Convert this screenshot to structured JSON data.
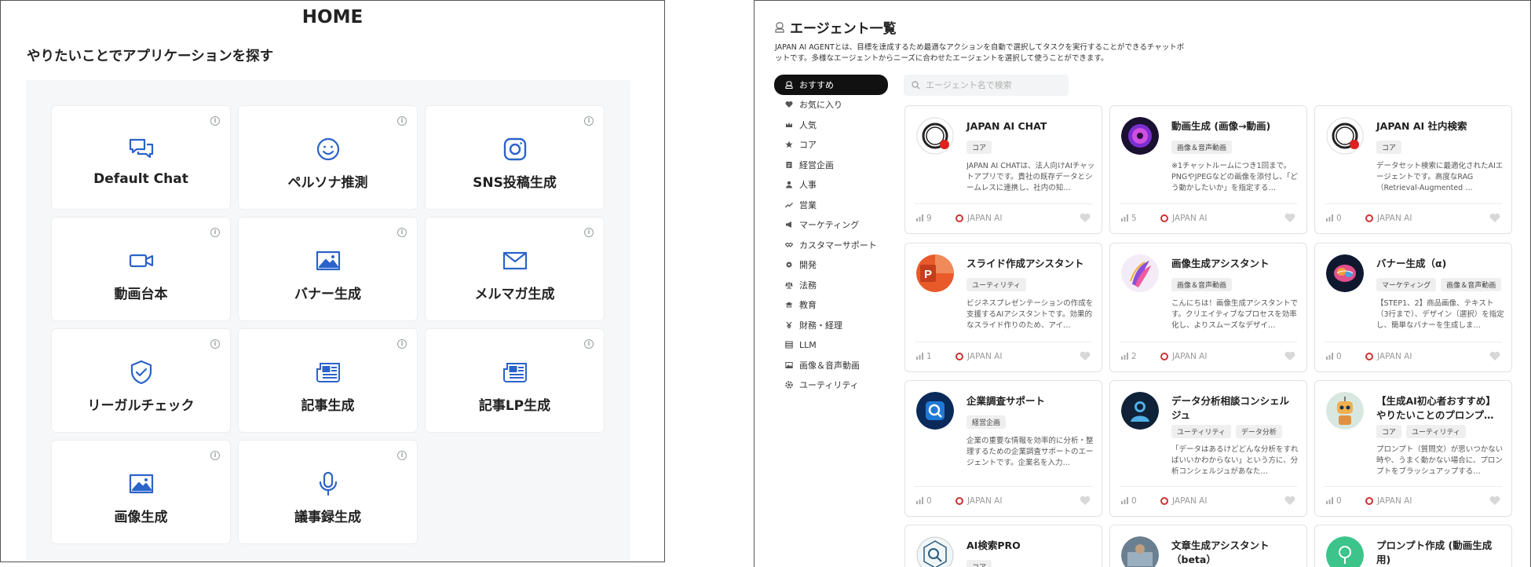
{
  "home": {
    "title": "HOME",
    "section_title": "やりたいことでアプリケーションを探す",
    "info_glyph": "i",
    "apps": [
      {
        "label": "Default Chat",
        "icon": "chat-bubbles-icon"
      },
      {
        "label": "ペルソナ推測",
        "icon": "smiley-icon"
      },
      {
        "label": "SNS投稿生成",
        "icon": "instagram-icon"
      },
      {
        "label": "動画台本",
        "icon": "video-camera-icon"
      },
      {
        "label": "バナー生成",
        "icon": "image-icon"
      },
      {
        "label": "メルマガ生成",
        "icon": "mail-icon"
      },
      {
        "label": "リーガルチェック",
        "icon": "shield-check-icon"
      },
      {
        "label": "記事生成",
        "icon": "newspaper-icon"
      },
      {
        "label": "記事LP生成",
        "icon": "newspaper-icon"
      },
      {
        "label": "画像生成",
        "icon": "image-icon"
      },
      {
        "label": "議事録生成",
        "icon": "microphone-icon"
      }
    ],
    "accent_color": "#2b63c9"
  },
  "agents": {
    "title": "エージェント一覧",
    "description": "JAPAN AI AGENTとは、目標を達成するため最適なアクションを自動で選択してタスクを実行することができるチャットボットです。多様なエージェントからニーズに合わせたエージェントを選択して使うことができます。",
    "search_placeholder": "エージェント名で検索",
    "sidebar": [
      {
        "label": "おすすめ",
        "icon": "person-icon",
        "active": true
      },
      {
        "label": "お気に入り",
        "icon": "heart-icon"
      },
      {
        "label": "人気",
        "icon": "crown-icon"
      },
      {
        "label": "コア",
        "icon": "star-icon"
      },
      {
        "label": "経営企画",
        "icon": "document-icon"
      },
      {
        "label": "人事",
        "icon": "person-icon"
      },
      {
        "label": "営業",
        "icon": "trend-icon"
      },
      {
        "label": "マーケティング",
        "icon": "megaphone-icon"
      },
      {
        "label": "カスタマーサポート",
        "icon": "handshake-icon"
      },
      {
        "label": "開発",
        "icon": "gear-icon"
      },
      {
        "label": "法務",
        "icon": "scales-icon"
      },
      {
        "label": "教育",
        "icon": "graduation-icon"
      },
      {
        "label": "財務・経理",
        "icon": "yen-icon"
      },
      {
        "label": "LLM",
        "icon": "server-icon"
      },
      {
        "label": "画像＆音声動画",
        "icon": "image-icon"
      },
      {
        "label": "ユーティリティ",
        "icon": "gear-icon"
      }
    ],
    "cards": [
      {
        "title": "JAPAN AI CHAT",
        "tags": [
          "コア"
        ],
        "desc": "JAPAN AI CHATは、法人向けAIチャットアプリです。貴社の既存データとシームレスに連携し、社内の知…",
        "count": "9",
        "brand": "JAPAN AI",
        "avatar": "ring-avatar"
      },
      {
        "title": "動画生成 (画像→動画)",
        "tags": [
          "画像＆音声動画"
        ],
        "desc": "※1チャットルームにつき1回まで。PNGやJPEGなどの画像を添付し、「どう動かしたいか」を指定する…",
        "count": "5",
        "brand": "JAPAN AI",
        "avatar": "purple-orb-avatar"
      },
      {
        "title": "JAPAN AI 社内検索",
        "tags": [
          "コア"
        ],
        "desc": "データセット検索に最適化されたAIエージェントです。高度なRAG（Retrieval-Augmented …",
        "count": "0",
        "brand": "JAPAN AI",
        "avatar": "ring-avatar"
      },
      {
        "title": "スライド作成アシスタント",
        "tags": [
          "ユーティリティ"
        ],
        "desc": "ビジネスプレゼンテーションの作成を支援するAIアシスタントです。効果的なスライド作りのため、アイ…",
        "count": "1",
        "brand": "JAPAN AI",
        "avatar": "ppt-avatar"
      },
      {
        "title": "画像生成アシスタント",
        "tags": [
          "画像＆音声動画"
        ],
        "desc": "こんにちは！画像生成アシスタントです。クリエイティブなプロセスを効率化し、よりスムーズなデザイ…",
        "count": "2",
        "brand": "JAPAN AI",
        "avatar": "paint-avatar"
      },
      {
        "title": "バナー生成（α)",
        "tags": [
          "マーケティング",
          "画像＆音声動画"
        ],
        "desc": "【STEP1、2】商品画像、テキスト（3行まで）、デザイン（選択）を指定し、簡単なバナーを生成しま…",
        "count": "0",
        "brand": "JAPAN AI",
        "avatar": "brain-avatar"
      },
      {
        "title": "企業調査サポート",
        "tags": [
          "経営企画"
        ],
        "desc": "企業の重要な情報を効率的に分析・整理するための企業調査サポートのエージェントです。企業名を入力…",
        "count": "0",
        "brand": "JAPAN AI",
        "avatar": "search-app-avatar"
      },
      {
        "title": "データ分析相談コンシェルジュ",
        "tags": [
          "ユーティリティ",
          "データ分析"
        ],
        "desc": "「データはあるけどどんな分析をすればいいかわからない」という方に、分析コンシェルジュがあなた…",
        "count": "0",
        "brand": "JAPAN AI",
        "avatar": "concierge-avatar"
      },
      {
        "title": "【生成AI初心者おすすめ】やりたいことのプロンプ…",
        "tags": [
          "コア",
          "ユーティリティ"
        ],
        "desc": "プロンプト（質問文）が思いつかない時や、うまく動かない場合に、プロンプトをブラッシュアップする…",
        "count": "0",
        "brand": "JAPAN AI",
        "avatar": "robot-avatar"
      },
      {
        "title": "AI検索PRO",
        "tags": [
          "コア"
        ],
        "desc": "",
        "count": "",
        "brand": "",
        "avatar": "hex-search-avatar"
      },
      {
        "title": "文章生成アシスタント（beta）",
        "tags": [],
        "desc": "",
        "count": "",
        "brand": "",
        "avatar": "photo-avatar"
      },
      {
        "title": "プロンプト作成 (動画生成用)",
        "tags": [],
        "desc": "",
        "count": "",
        "brand": "",
        "avatar": "green-avatar"
      }
    ]
  }
}
